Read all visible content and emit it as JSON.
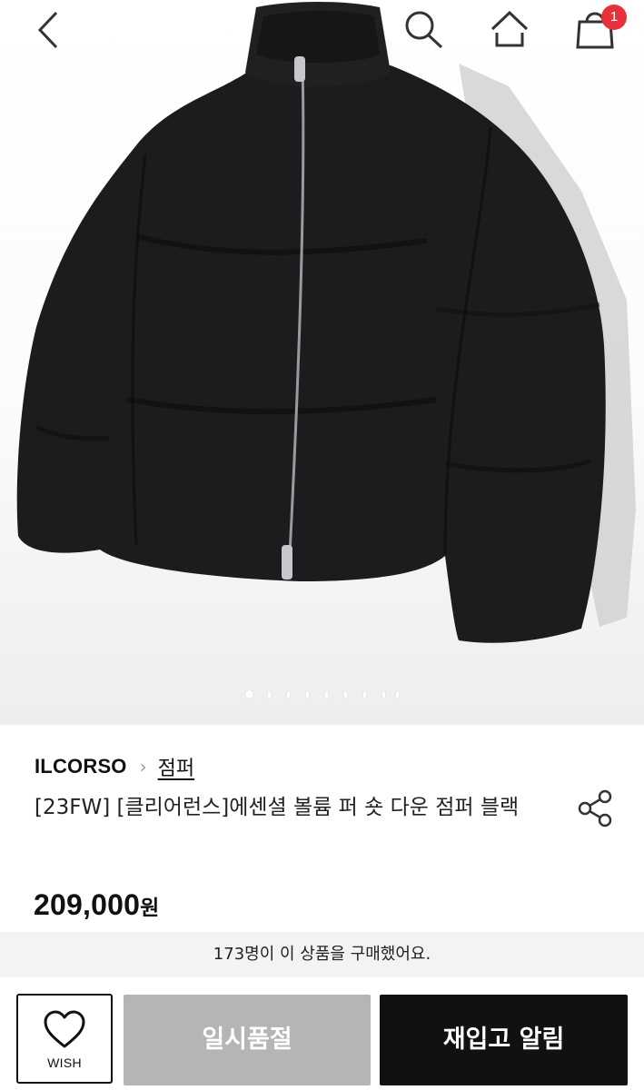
{
  "header": {
    "back_icon": "chevron-left-icon",
    "search_icon": "search-icon",
    "home_icon": "home-icon",
    "cart_icon": "shopping-bag-icon",
    "cart_count": "1"
  },
  "gallery": {
    "image_alt": "black puffer down jacket",
    "current_index": 1,
    "total": 9
  },
  "product": {
    "brand": "ILCORSO",
    "category": "점퍼",
    "title": "[23FW] [클리어런스]에센셜 볼륨 퍼 숏 다운 점퍼 블랙",
    "price": "209,000",
    "price_unit": "원",
    "purchase_note": "173명이 이 상품을 구매했어요."
  },
  "actions": {
    "wish_label": "WISH",
    "soldout_label": "일시품절",
    "restock_label": "재입고 알림"
  },
  "colors": {
    "badge": "#e8323b",
    "soldout_bg": "#b5b5b5",
    "restock_bg": "#111111",
    "purchase_bar_bg": "#f3f3f3"
  }
}
